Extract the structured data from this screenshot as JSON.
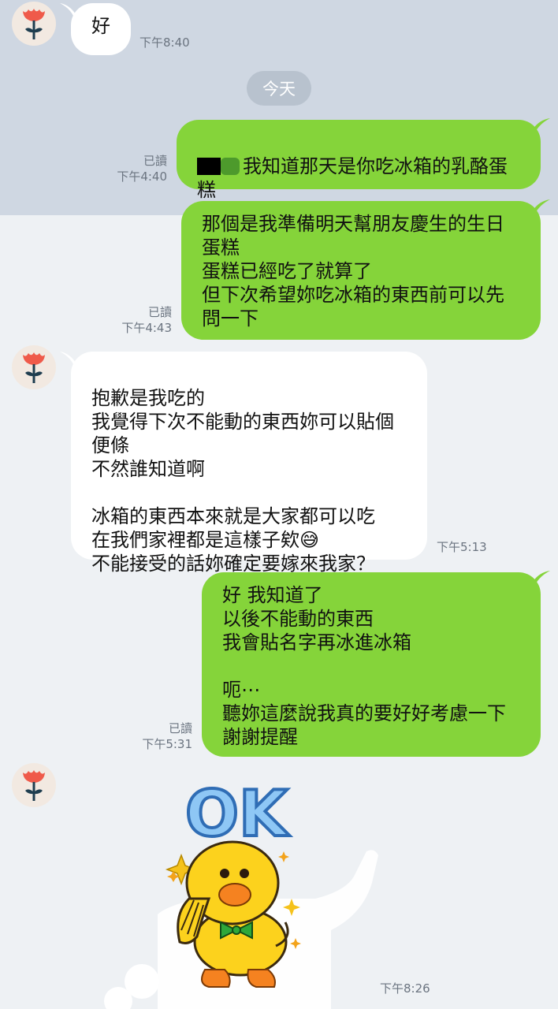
{
  "date_divider": "今天",
  "read_label": "已讀",
  "messages": [
    {
      "text": "好",
      "time": "下午8:40"
    },
    {
      "text": "我知道那天是你吃冰箱的乳酪蛋\n糕",
      "time": "下午4:40"
    },
    {
      "text": "那個是我準備明天幫朋友慶生的生日\n蛋糕\n蛋糕已經吃了就算了\n但下次希望妳吃冰箱的東西前可以先\n問一下",
      "time": "下午4:43"
    },
    {
      "text": "抱歉是我吃的\n我覺得下次不能動的東西妳可以貼個\n便條\n不然誰知道啊\n\n冰箱的東西本來就是大家都可以吃\n在我們家裡都是這樣子欸",
      "text_tail": "不能接受的話妳確定要嫁來我家？",
      "emoji": "😅",
      "time": "下午5:13"
    },
    {
      "text": "好 我知道了\n以後不能動的東西\n我會貼名字再冰進冰箱\n\n呃⋯\n聽妳這麼說我真的要好好考慮一下\n謝謝提醒",
      "time": "下午5:31"
    },
    {
      "sticker_text": "OK",
      "time": "下午8:26"
    }
  ],
  "colors": {
    "outgoing": "#85d43a",
    "incoming": "#ffffff",
    "top_band": "#cfd7e2",
    "bg": "#eef1f4"
  },
  "icons": {
    "avatar": "red-flower-icon",
    "sticker": "duck-ok-sticker"
  }
}
